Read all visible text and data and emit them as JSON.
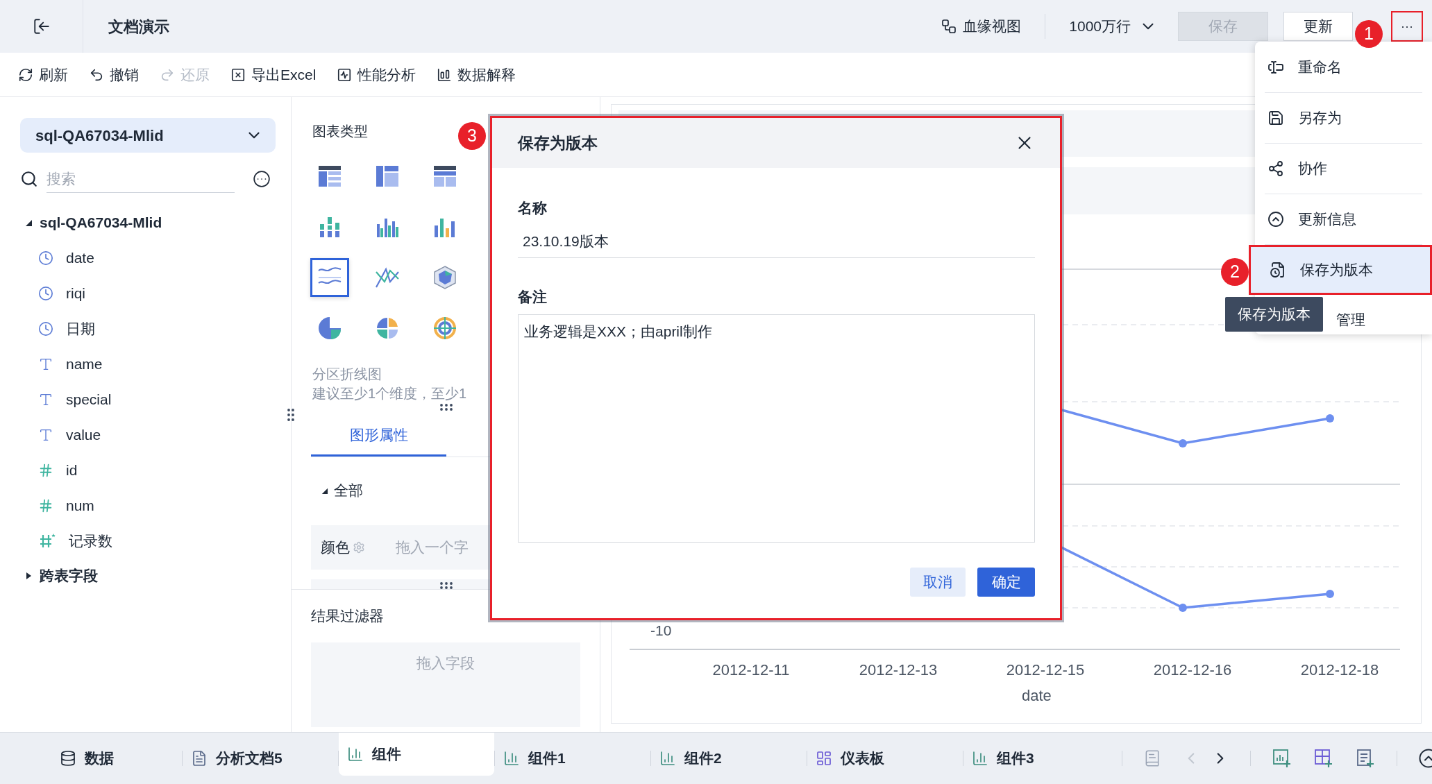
{
  "header": {
    "title": "文档演示",
    "lineage_button": "血缘视图",
    "row_limit": "1000万行",
    "save_button": {
      "label": "保存",
      "disabled": true
    },
    "update_button": "更新",
    "more_button": "···"
  },
  "toolbar": [
    {
      "kind": "refresh",
      "label": "刷新",
      "disabled": false
    },
    {
      "kind": "undo",
      "label": "撤销",
      "disabled": false
    },
    {
      "kind": "redo",
      "label": "还原",
      "disabled": true
    },
    {
      "kind": "export",
      "label": "导出Excel",
      "disabled": false
    },
    {
      "kind": "performance",
      "label": "性能分析",
      "disabled": false
    },
    {
      "kind": "explain",
      "label": "数据解释",
      "disabled": false
    }
  ],
  "data_panel": {
    "dataset": "sql-QA67034-Mlid",
    "search": {
      "placeholder": "搜索"
    },
    "tree": [
      {
        "label": "sql-QA67034-Mlid",
        "expanded": true,
        "children": [
          {
            "kind": "time",
            "label": "date"
          },
          {
            "kind": "time",
            "label": "riqi"
          },
          {
            "kind": "time",
            "label": "日期"
          },
          {
            "kind": "text",
            "label": "name"
          },
          {
            "kind": "text",
            "label": "special"
          },
          {
            "kind": "text",
            "label": "value"
          },
          {
            "kind": "number",
            "label": "id"
          },
          {
            "kind": "number",
            "label": "num"
          },
          {
            "kind": "calculated",
            "label": "记录数"
          }
        ]
      },
      {
        "label": "跨表字段",
        "expanded": false
      }
    ]
  },
  "chart_panel": {
    "title": "图表类型",
    "chart_types": [
      {
        "kind": "table",
        "selected": false
      },
      {
        "kind": "grouped-table",
        "selected": false
      },
      {
        "kind": "cross-table",
        "selected": false
      },
      {
        "kind": "stacked-bar",
        "selected": false
      },
      {
        "kind": "grouped-bar",
        "selected": false
      },
      {
        "kind": "bar",
        "selected": false
      },
      {
        "kind": "area-line",
        "selected": true
      },
      {
        "kind": "line",
        "selected": false
      },
      {
        "kind": "radar",
        "selected": false
      },
      {
        "kind": "pie",
        "selected": false
      },
      {
        "kind": "multi-pie",
        "selected": false
      },
      {
        "kind": "ring",
        "selected": false
      }
    ],
    "type_name": "分区折线图",
    "type_hint": "建议至少1个维度，至少1",
    "tabs": [
      {
        "label": "图形属性",
        "selected": true
      }
    ],
    "section": {
      "label": "全部",
      "expanded": true
    },
    "color_row": {
      "label": "颜色",
      "placeholder": "拖入一个字"
    },
    "filter_title": "结果过滤器",
    "filter_drop": "拖入字段"
  },
  "chart": {
    "y_tick": "-10",
    "x_labels": [
      "2012-12-11",
      "2012-12-13",
      "2012-12-15",
      "2012-12-16",
      "2012-12-18"
    ],
    "x_title": "date"
  },
  "dialog": {
    "title": "保存为版本",
    "name_label": "名称",
    "name_value": "23.10.19版本",
    "note_label": "备注",
    "note_value": "业务逻辑是XXX；由april制作",
    "cancel": "取消",
    "confirm": "确定"
  },
  "menu": [
    {
      "kind": "rename",
      "label": "重命名",
      "selected": false
    },
    {
      "kind": "save-as",
      "label": "另存为",
      "selected": false
    },
    {
      "kind": "share",
      "label": "协作",
      "selected": false
    },
    {
      "kind": "update-info",
      "label": "更新信息",
      "selected": false
    },
    {
      "kind": "version",
      "label": "保存为版本",
      "selected": true
    },
    {
      "kind": "partial",
      "label": "管理",
      "selected": false
    }
  ],
  "tooltip": "保存为版本",
  "annotations": [
    {
      "label": "1"
    },
    {
      "label": "2"
    },
    {
      "label": "3"
    }
  ],
  "bottom_tabs": [
    {
      "kind": "data",
      "label": "数据",
      "selected": false
    },
    {
      "kind": "doc",
      "label": "分析文档5",
      "selected": false
    },
    {
      "kind": "component",
      "label": "组件",
      "selected": true
    },
    {
      "kind": "component",
      "label": "组件1",
      "selected": false
    },
    {
      "kind": "component",
      "label": "组件2",
      "selected": false
    },
    {
      "kind": "dashboard",
      "label": "仪表板",
      "selected": false
    },
    {
      "kind": "component",
      "label": "组件3",
      "selected": false
    }
  ]
}
